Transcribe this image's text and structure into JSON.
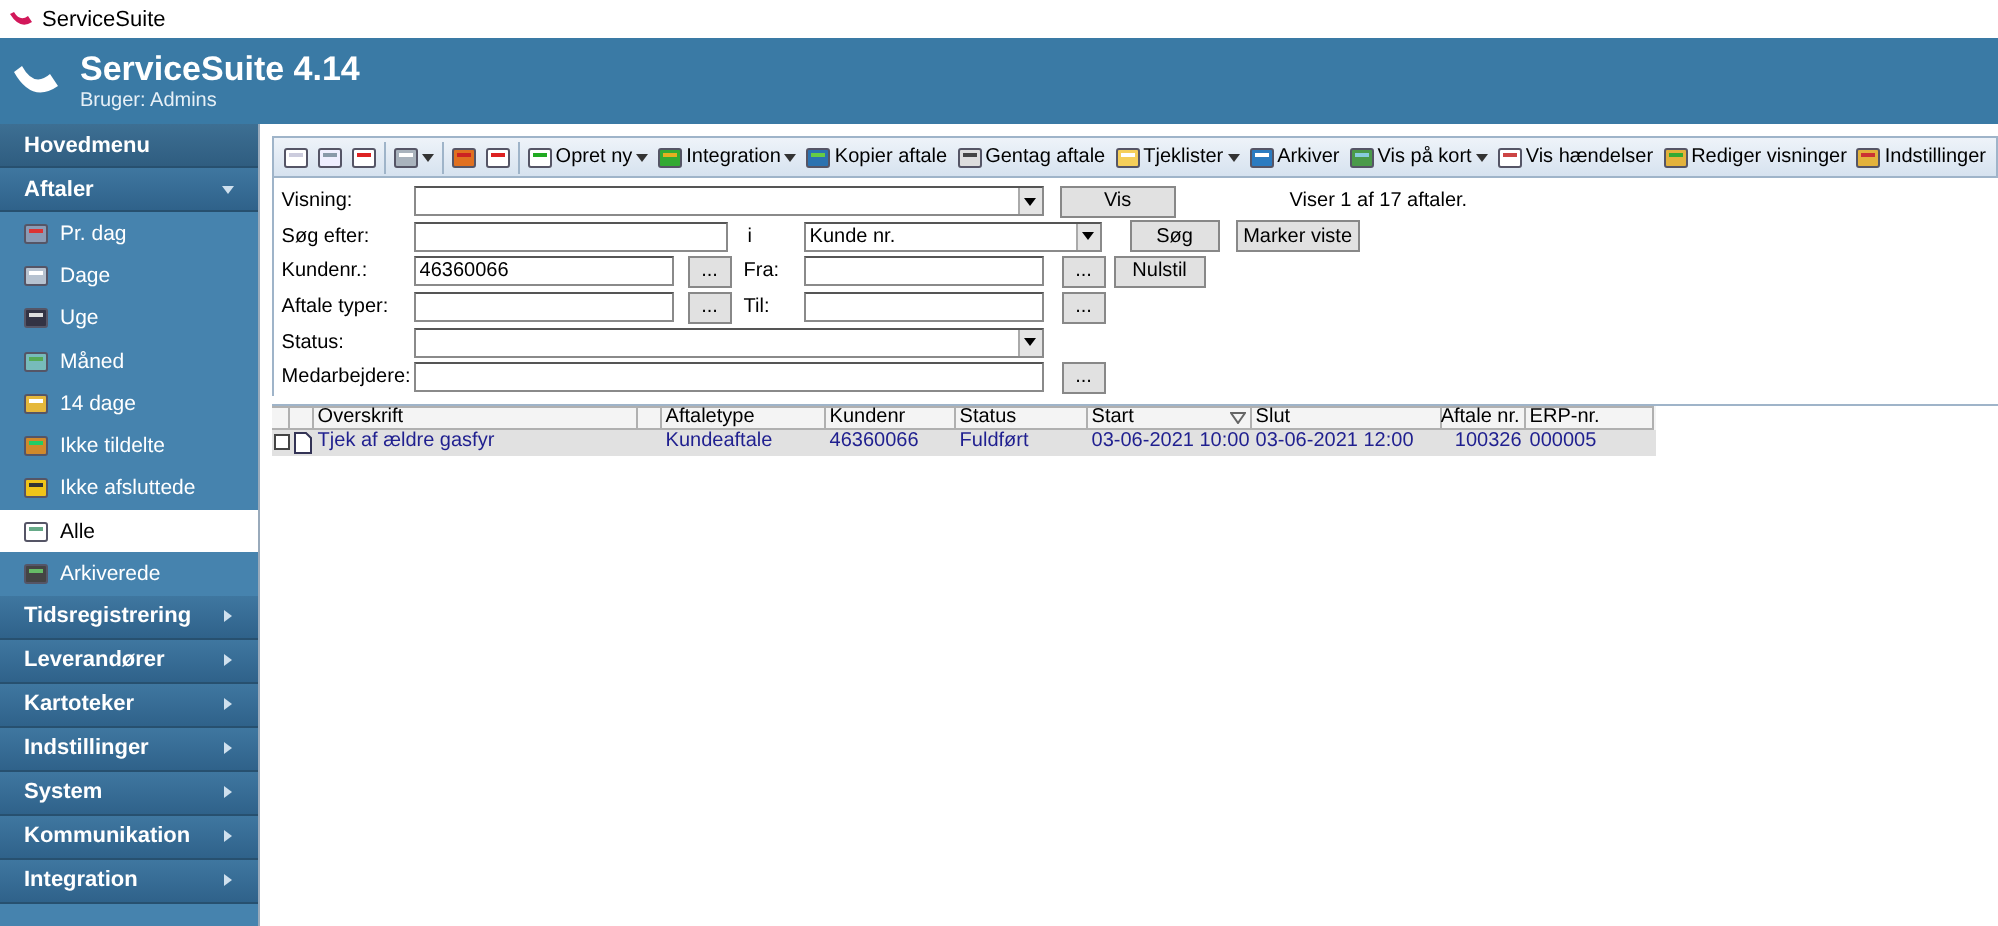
{
  "window": {
    "title": "ServiceSuite"
  },
  "header": {
    "title": "ServiceSuite 4.14",
    "user": "Bruger:  Admins"
  },
  "sidebar": {
    "menu_title": "Hovedmenu",
    "sections": [
      {
        "title": "Aftaler",
        "expanded": true,
        "items": [
          {
            "label": "Pr. dag",
            "selected": false
          },
          {
            "label": "Dage",
            "selected": false
          },
          {
            "label": "Uge",
            "selected": false
          },
          {
            "label": "Måned",
            "selected": false
          },
          {
            "label": "14 dage",
            "selected": false
          },
          {
            "label": "Ikke tildelte",
            "selected": false
          },
          {
            "label": "Ikke afsluttede",
            "selected": false
          },
          {
            "label": "Alle",
            "selected": true
          },
          {
            "label": "Arkiverede",
            "selected": false
          }
        ]
      },
      {
        "title": "Tidsregistrering",
        "expanded": false
      },
      {
        "title": "Leverandører",
        "expanded": false
      },
      {
        "title": "Kartoteker",
        "expanded": false
      },
      {
        "title": "Indstillinger",
        "expanded": false
      },
      {
        "title": "System",
        "expanded": false
      },
      {
        "title": "Kommunikation",
        "expanded": false
      },
      {
        "title": "Integration",
        "expanded": false
      }
    ]
  },
  "toolbar": [
    {
      "kind": "icon",
      "dropdown": false
    },
    {
      "kind": "icon",
      "dropdown": false
    },
    {
      "kind": "icon",
      "dropdown": false
    },
    {
      "kind": "separator"
    },
    {
      "kind": "icon",
      "dropdown": true
    },
    {
      "kind": "separator"
    },
    {
      "kind": "icon",
      "dropdown": false
    },
    {
      "kind": "icon",
      "dropdown": false
    },
    {
      "kind": "separator"
    },
    {
      "kind": "labeled",
      "label": "Opret ny",
      "dropdown": true
    },
    {
      "kind": "labeled",
      "label": "Integration",
      "dropdown": true
    },
    {
      "kind": "labeled",
      "label": "Kopier aftale",
      "dropdown": false
    },
    {
      "kind": "labeled",
      "label": "Gentag aftale",
      "dropdown": false
    },
    {
      "kind": "labeled",
      "label": "Tjeklister",
      "dropdown": true
    },
    {
      "kind": "labeled",
      "label": "Arkiver",
      "dropdown": false
    },
    {
      "kind": "labeled",
      "label": "Vis på kort",
      "dropdown": true
    },
    {
      "kind": "labeled",
      "label": "Vis hændelser",
      "dropdown": false
    },
    {
      "kind": "labeled",
      "label": "Rediger visninger",
      "dropdown": false
    },
    {
      "kind": "labeled",
      "label": "Indstillinger",
      "dropdown": false
    }
  ],
  "filter": {
    "visning": {
      "label": "Visning:"
    },
    "vis_button": "Vis",
    "result": "Viser 1 af 17 aftaler.",
    "search": {
      "label": "Søg efter:"
    },
    "in_label": "i",
    "search_in": {
      "value": "Kunde nr."
    },
    "search_button": "Søg",
    "mark_button": "Marker viste",
    "customer": {
      "label": "Kundenr.:",
      "value": "46360066",
      "browse": "..."
    },
    "from": {
      "label": "Fra:",
      "browse": "..."
    },
    "reset_button": "Nulstil",
    "types": {
      "label": "Aftale typer:",
      "browse": "..."
    },
    "to": {
      "label": "Til:",
      "browse": "..."
    },
    "status": {
      "label": "Status:"
    },
    "employees": {
      "label": "Medarbejdere:",
      "browse": "..."
    }
  },
  "table": {
    "columns": [
      {
        "label": "Overskrift",
        "sorted": false
      },
      {
        "label": "Aftaletype",
        "sorted": false
      },
      {
        "label": "Kundenr",
        "sorted": false
      },
      {
        "label": "Status",
        "sorted": false
      },
      {
        "label": "Start",
        "sorted": true
      },
      {
        "label": "Slut",
        "sorted": false
      },
      {
        "label": "Aftale nr.",
        "sorted": false
      },
      {
        "label": "ERP-nr.",
        "sorted": false
      }
    ],
    "rows": [
      {
        "selected": true,
        "checked": false,
        "cells": [
          "Tjek af ældre gasfyr",
          "Kundeaftale",
          "46360066",
          "Fuldført",
          "03-06-2021 10:00",
          "03-06-2021 12:00",
          "100326",
          "000005"
        ]
      }
    ]
  }
}
